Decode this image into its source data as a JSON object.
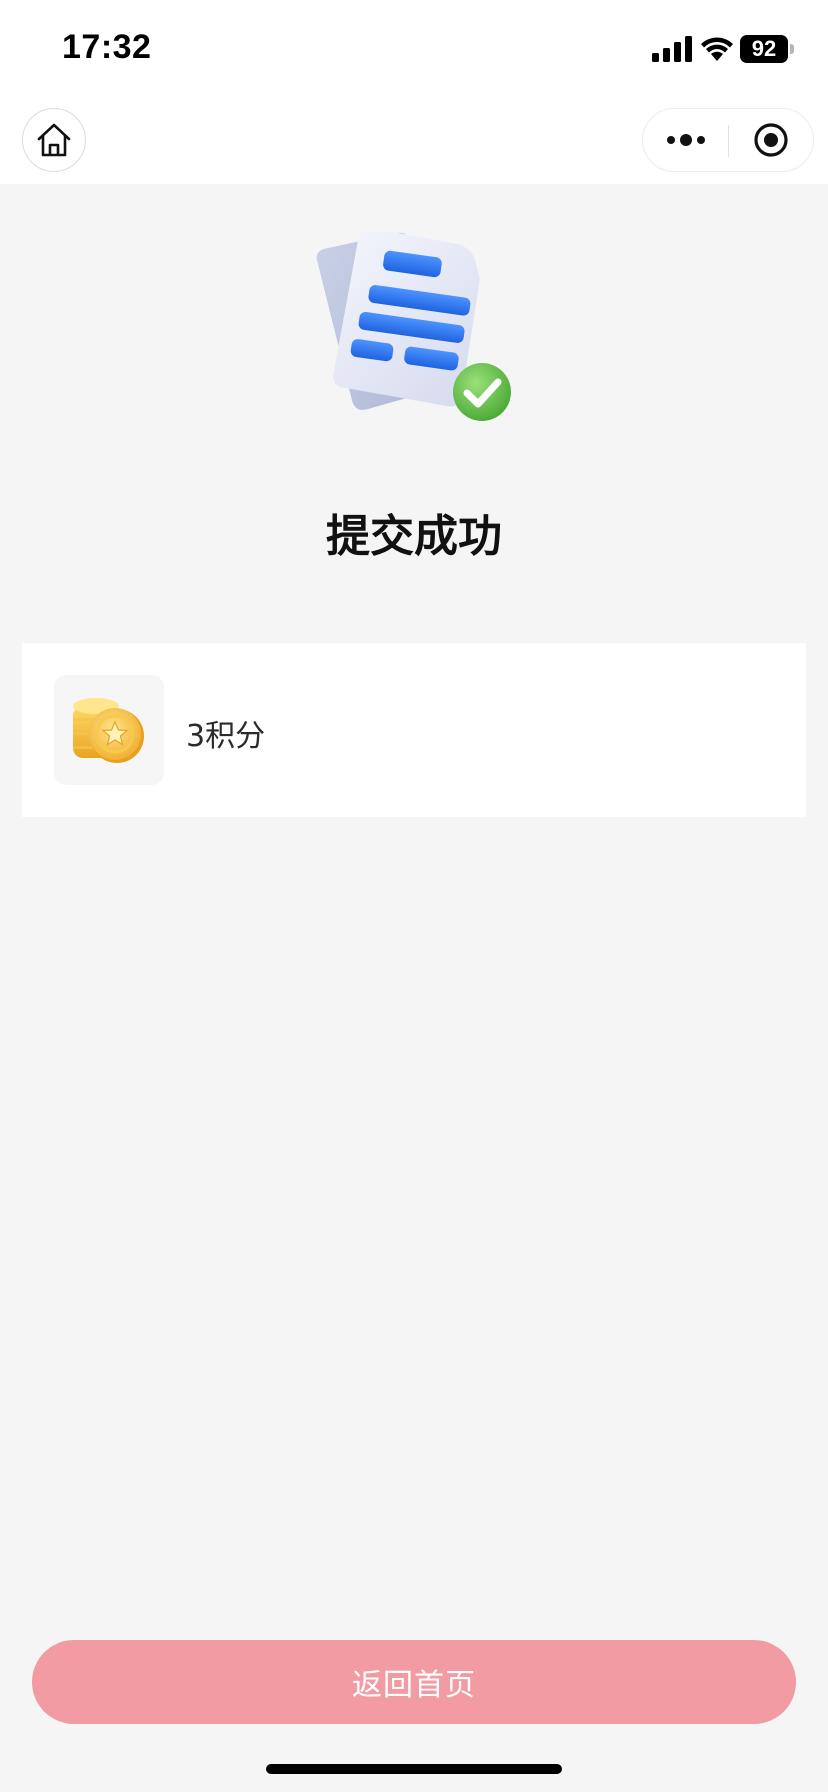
{
  "status_bar": {
    "time": "17:32",
    "battery_level": "92",
    "icons": [
      "signal-icon",
      "wifi-icon",
      "battery-icon"
    ]
  },
  "nav_bar": {
    "icons": [
      "home-icon",
      "more-dots-icon",
      "close-target-icon"
    ]
  },
  "result": {
    "illustration": "document-check-icon",
    "title": "提交成功"
  },
  "reward": {
    "icon": "gold-coins-icon",
    "text": "3积分"
  },
  "footer": {
    "button_label": "返回首页"
  },
  "colors": {
    "background": "#f5f5f5",
    "card": "#ffffff",
    "primary_button": "#f29ba2",
    "doc_blue": "#2f7cf0",
    "check_green": "#6cc24a",
    "coin_gold": "#f4b73a"
  }
}
